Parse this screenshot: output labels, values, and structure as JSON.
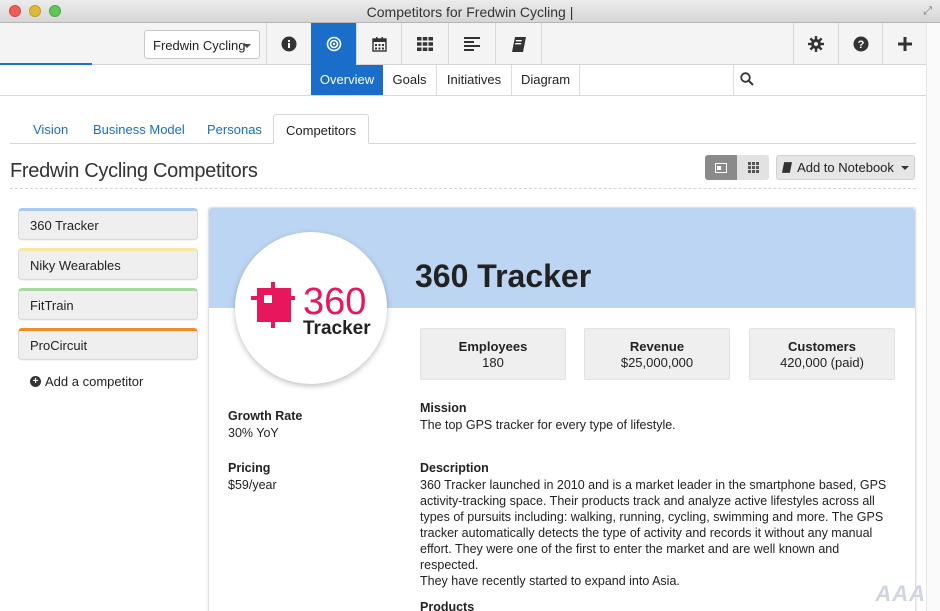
{
  "window": {
    "title": "Competitors for Fredwin Cycling |"
  },
  "toolbar": {
    "org_select": "Fredwin Cycling",
    "icons": [
      "info-icon",
      "target-icon",
      "calendar-icon",
      "grid-icon",
      "list-icon",
      "notebook-icon",
      "gear-icon",
      "help-icon",
      "plus-icon"
    ],
    "active": "target-icon"
  },
  "subnav": {
    "tabs": [
      "Overview",
      "Goals",
      "Initiatives",
      "Diagram"
    ],
    "active": "Overview"
  },
  "content_tabs": {
    "tabs": [
      "Vision",
      "Business Model",
      "Personas",
      "Competitors"
    ],
    "active": "Competitors"
  },
  "page": {
    "title": "Fredwin Cycling Competitors",
    "add_notebook_label": "Add to Notebook"
  },
  "competitors": {
    "items": [
      {
        "name": "360 Tracker",
        "color": "#a9c9f0"
      },
      {
        "name": "Niky Wearables",
        "color": "#f6e7a0"
      },
      {
        "name": "FitTrain",
        "color": "#a9d8a2"
      },
      {
        "name": "ProCircuit",
        "color": "#f28c28"
      }
    ],
    "add_label": "Add a competitor"
  },
  "detail": {
    "name": "360 Tracker",
    "logo": {
      "number": "360",
      "word": "Tracker",
      "color": "#e8175d"
    },
    "header_color": "#bcd5f2",
    "stats": [
      {
        "label": "Employees",
        "value": "180"
      },
      {
        "label": "Revenue",
        "value": "$25,000,000"
      },
      {
        "label": "Customers",
        "value": "420,000 (paid)"
      }
    ],
    "growth_rate": {
      "label": "Growth Rate",
      "value": "30% YoY"
    },
    "pricing": {
      "label": "Pricing",
      "value": "$59/year"
    },
    "mission": {
      "label": "Mission",
      "value": "The top GPS tracker for every type of lifestyle."
    },
    "description": {
      "label": "Description",
      "lines": [
        "360 Tracker launched in 2010 and is a market leader in the smartphone based, GPS",
        "activity-tracking space. Their products track and analyze active lifestyles across all",
        "types of pursuits including: walking, running, cycling, swimming and more. The GPS",
        "tracker automatically detects the type of activity and records it without any manual",
        "effort. They were one of the first to enter the market and are well known and respected.",
        "They have recently started to expand into Asia."
      ]
    },
    "products": {
      "label": "Products"
    }
  },
  "watermark": "AAA"
}
